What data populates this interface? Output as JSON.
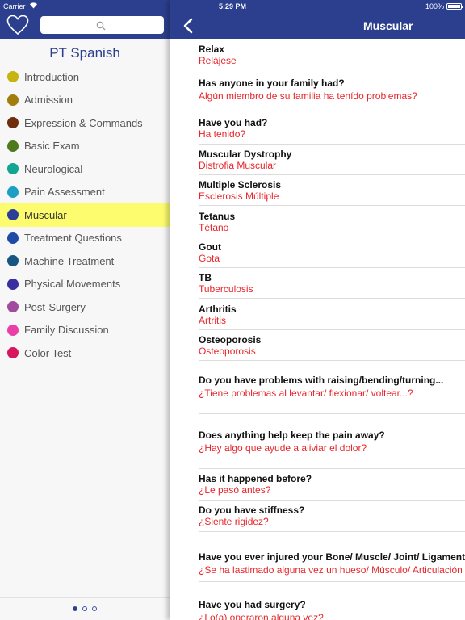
{
  "status": {
    "carrier": "Carrier",
    "time": "5:29 PM",
    "battery": "100%"
  },
  "sidebar": {
    "title": "PT Spanish",
    "search_placeholder": "",
    "items": [
      {
        "label": "Introduction",
        "color": "#c6b411"
      },
      {
        "label": "Admission",
        "color": "#a27d0e"
      },
      {
        "label": "Expression & Commands",
        "color": "#6e2e0d"
      },
      {
        "label": "Basic Exam",
        "color": "#4e7a1f"
      },
      {
        "label": "Neurological",
        "color": "#12a593"
      },
      {
        "label": "Pain Assessment",
        "color": "#1b9fc4"
      },
      {
        "label": "Muscular",
        "color": "#2b3f99",
        "active": true
      },
      {
        "label": "Treatment Questions",
        "color": "#1d4aa6"
      },
      {
        "label": "Machine Treatment",
        "color": "#165681"
      },
      {
        "label": "Physical Movements",
        "color": "#3a2f9f"
      },
      {
        "label": "Post-Surgery",
        "color": "#a14b9c"
      },
      {
        "label": "Family Discussion",
        "color": "#ea3fa8"
      },
      {
        "label": "Color Test",
        "color": "#d8155f"
      }
    ],
    "page_indicator": {
      "pages": 3,
      "current": 1
    }
  },
  "main": {
    "title": "Muscular",
    "phrases": [
      {
        "en": "Relax",
        "es": "Relájese"
      },
      {
        "en": "Has anyone in your family had?",
        "es": "Algún miembro de su familia ha tenído problemas?"
      },
      {
        "en": "Have you had?",
        "es": "Ha tenido?"
      },
      {
        "en": "Muscular Dystrophy",
        "es": "Distrofia Muscular"
      },
      {
        "en": "Multiple Sclerosis",
        "es": "Esclerosis Múltiple"
      },
      {
        "en": "Tetanus",
        "es": "Tétano"
      },
      {
        "en": "Gout",
        "es": "Gota"
      },
      {
        "en": "TB",
        "es": "Tuberculosis"
      },
      {
        "en": "Arthritis",
        "es": "Artritis"
      },
      {
        "en": "Osteoporosis",
        "es": "Osteoporosis"
      },
      {
        "en": "Do you have problems with raising/bending/turning...",
        "es": "¿Tiene problemas al levantar/ flexionar/ voltear...?"
      },
      {
        "en": "Does anything help keep the pain away?",
        "es": "¿Hay algo que ayude a aliviar el dolor?"
      },
      {
        "en": "Has it happened before?",
        "es": "¿Le pasó antes?"
      },
      {
        "en": "Do you have stiffness?",
        "es": "¿Siente rigidez?"
      },
      {
        "en": "Have you ever injured your Bone/ Muscle/ Joint/ Ligament?",
        "es": "¿Se ha lastimado alguna vez un  hueso/ Músculo/ Articulación"
      },
      {
        "en": "Have you had surgery?",
        "es": "¿Lo(a) operaron alguna vez?"
      }
    ]
  }
}
